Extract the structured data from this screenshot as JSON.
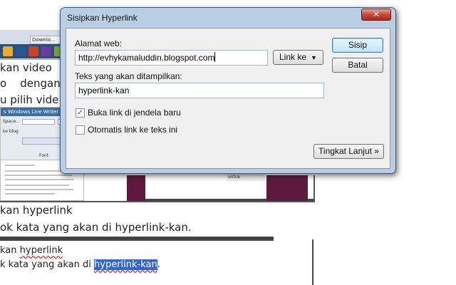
{
  "background": {
    "lines": [
      "kan video",
      "o    dengan",
      "u pilih vide",
      "kan hyperlink",
      "ok kata yang akan di hyperlink-kan."
    ],
    "line6_prefix": "kan ",
    "line6_word": "hyperlink",
    "line7_prefix": "k kata yang akan di ",
    "line7_highlight": "hyperlink-kan",
    "line7_suffix": ".",
    "shot1_tab": "Downlo...",
    "shot2_title": "s Windows Live Writer",
    "shot2_space": "Space...",
    "shot2_blog": "ke blog",
    "shot2_font": "Font",
    "caption": "untuk ditampilkan di posting ini."
  },
  "dialog": {
    "title": "Sisipkan Hyperlink",
    "close_label": "✕",
    "url_label": "Alamat web:",
    "url_value": "http://evhykamaluddin.blogspot.com",
    "linkke_label": "Link ke",
    "text_label": "Teks yang akan ditampilkan:",
    "text_value": "hyperlink-kan",
    "checkbox_new_window": {
      "label": "Buka link di jendela baru",
      "checked": true
    },
    "checkbox_auto_link": {
      "label": "Otomatis link ke teks ini",
      "checked": false
    },
    "advanced_label": "Tingkat Lanjut »",
    "insert_label": "Sisip",
    "cancel_label": "Batal"
  },
  "colors": {
    "accent_plum": "#5e1a3e",
    "selection": "#3366cc",
    "close_red": "#c7473a"
  }
}
